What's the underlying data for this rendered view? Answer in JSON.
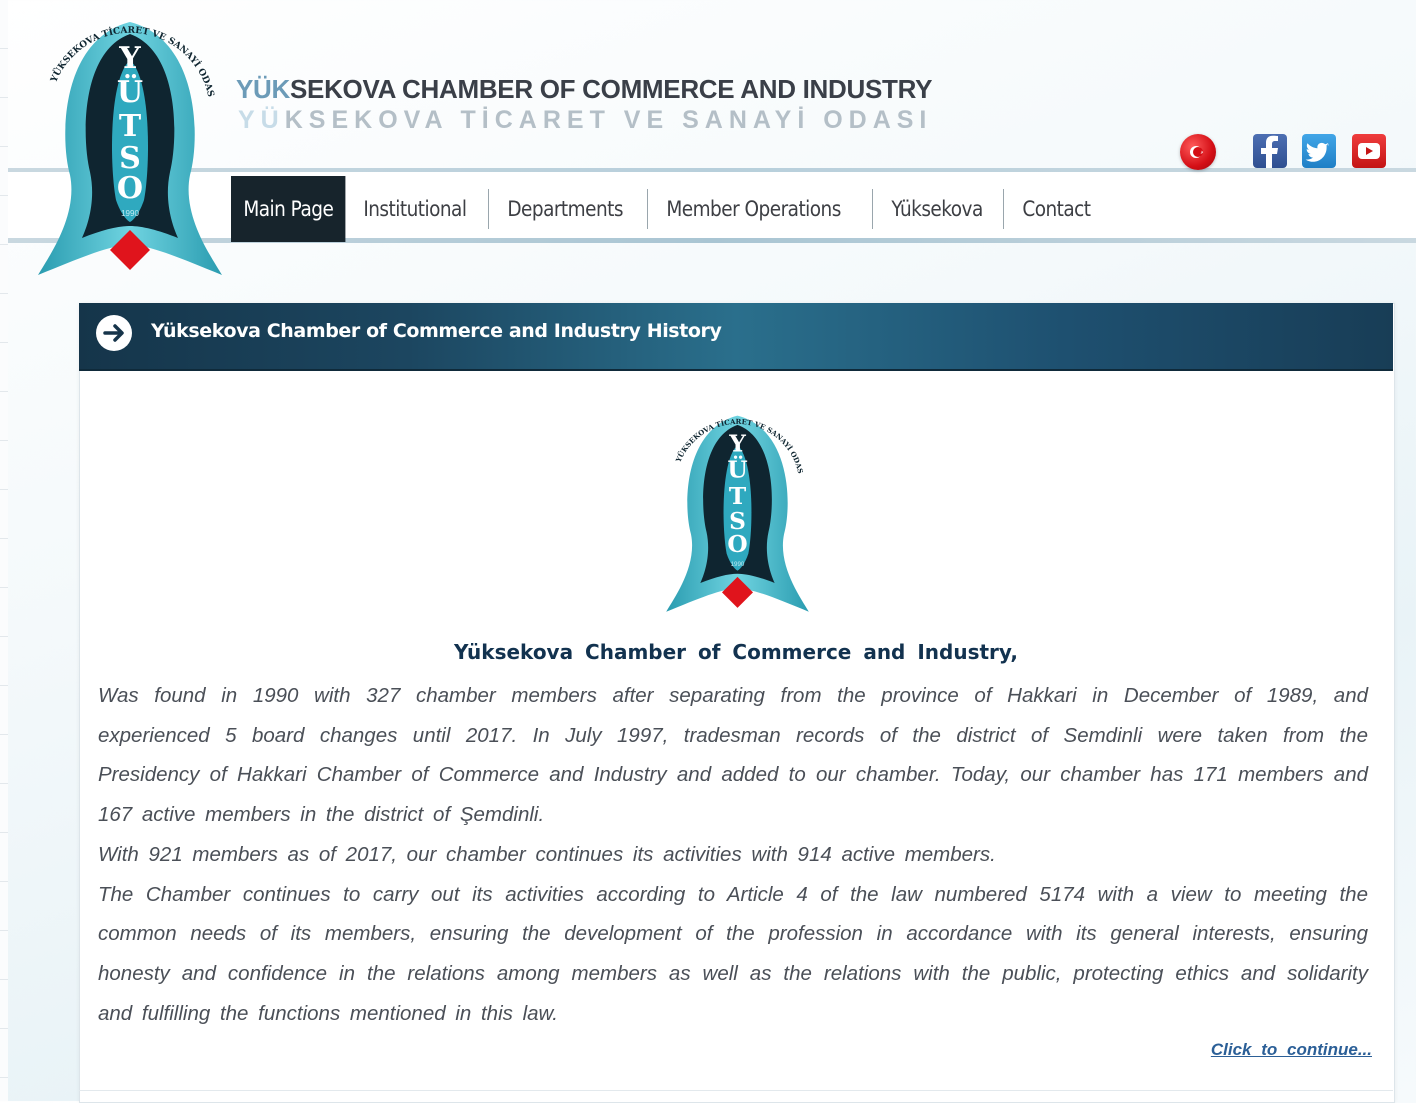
{
  "header": {
    "title_en_prefix": "YÜK",
    "title_en_rest": "SEKOVA  CHAMBER OF COMMERCE AND INDUSTRY",
    "title_tr_prefix": "YÜ",
    "title_tr_rest": "KSEKOVA  TİCARET VE SANAYİ ODASI"
  },
  "logo": {
    "ring_text": "YÜKSEKOVA TİCARET VE SANAYİ ODASI",
    "letters": [
      "Y",
      "Ü",
      "T",
      "S",
      "O"
    ],
    "year": "1990"
  },
  "socials": {
    "icons": [
      "turkish-flag-icon",
      "facebook-icon",
      "twitter-icon",
      "youtube-icon"
    ]
  },
  "nav": {
    "items": [
      {
        "label": "Main Page",
        "active": true
      },
      {
        "label": "Institutional"
      },
      {
        "label": "Departments"
      },
      {
        "label": "Member Operations"
      },
      {
        "label": "Yüksekova"
      },
      {
        "label": "Contact"
      }
    ]
  },
  "panel": {
    "title": "Yüksekova Chamber of Commerce and Industry History",
    "subtitle": "Yüksekova Chamber of Commerce and Industry,",
    "paragraphs": [
      "Was found in 1990 with 327 chamber members after separating from the province of Hakkari in December of 1989, and experienced 5 board changes until 2017. In July 1997, tradesman records of the district of Semdinli were taken from the Presidency of Hakkari Chamber of Commerce and Industry and added to our chamber. Today, our chamber has 171 members and 167 active members in the district of Şemdinli.",
      "With 921 members as of 2017, our chamber continues its activities with 914 active members.",
      "The Chamber continues to carry out its activities according to Article 4 of the law numbered 5174 with a view to meeting the common needs of its members, ensuring the development of the profession in accordance with its general interests, ensuring honesty and confidence in the relations among members as well as the relations with the public, protecting ethics and solidarity and fulfilling the functions mentioned in this law."
    ],
    "continue_link": "Click to continue..."
  },
  "colors": {
    "nav_active_bg": "#17242c",
    "panel_header": "#1c4660",
    "logo_teal": "#3fb6c9",
    "logo_dark": "#0f2530",
    "accent_red": "#e0141c",
    "link": "#2b5f97"
  }
}
